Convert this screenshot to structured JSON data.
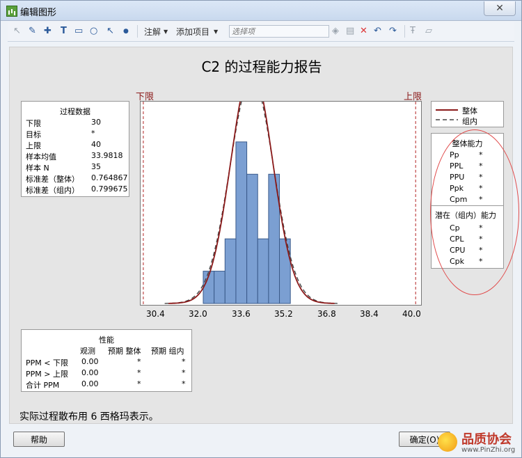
{
  "window": {
    "title": "编辑图形",
    "close": "✕"
  },
  "toolbar": {
    "annotate": "注解",
    "add_item": "添加项目",
    "select_placeholder": "选择项"
  },
  "report": {
    "title": "C2 的过程能力报告",
    "lsl_label": "下限",
    "usl_label": "上限"
  },
  "process_data": {
    "header": "过程数据",
    "rows": [
      {
        "label": "下限",
        "value": "30"
      },
      {
        "label": "目标",
        "value": "*"
      },
      {
        "label": "上限",
        "value": "40"
      },
      {
        "label": "样本均值",
        "value": "33.9818"
      },
      {
        "label": "样本 N",
        "value": "35"
      },
      {
        "label": "标准差（整体）",
        "value": "0.764867"
      },
      {
        "label": "标准差（组内）",
        "value": "0.799675"
      }
    ]
  },
  "legend": {
    "overall": "整体",
    "within": "组内"
  },
  "overall_capability": {
    "header": "整体能力",
    "rows": [
      {
        "label": "Pp",
        "value": "*"
      },
      {
        "label": "PPL",
        "value": "*"
      },
      {
        "label": "PPU",
        "value": "*"
      },
      {
        "label": "Ppk",
        "value": "*"
      },
      {
        "label": "Cpm",
        "value": "*"
      }
    ]
  },
  "potential_capability": {
    "header": "潜在（组内）能力",
    "rows": [
      {
        "label": "Cp",
        "value": "*"
      },
      {
        "label": "CPL",
        "value": "*"
      },
      {
        "label": "CPU",
        "value": "*"
      },
      {
        "label": "Cpk",
        "value": "*"
      }
    ]
  },
  "performance": {
    "header": "性能",
    "col_observed": "观测",
    "col_exp_overall": "预期 整体",
    "col_exp_within": "预期 组内",
    "rows": [
      {
        "label": "PPM < 下限",
        "obs": "0.00",
        "overall": "*",
        "within": "*"
      },
      {
        "label": "PPM > 上限",
        "obs": "0.00",
        "overall": "*",
        "within": "*"
      },
      {
        "label": "合计 PPM",
        "obs": "0.00",
        "overall": "*",
        "within": "*"
      }
    ]
  },
  "note": "实际过程散布用 6 西格玛表示。",
  "buttons": {
    "help": "帮助",
    "ok": "确定(O)"
  },
  "watermark": {
    "text": "品质协会",
    "url": "www.PinZhi.org"
  },
  "chart_data": {
    "type": "bar",
    "x_ticks": [
      "30.4",
      "32.0",
      "33.6",
      "35.2",
      "36.8",
      "38.4",
      "40.0"
    ],
    "xlim": [
      29.9,
      40.2
    ],
    "bins": [
      {
        "from": 32.2,
        "to": 32.6,
        "count": 1
      },
      {
        "from": 32.6,
        "to": 33.0,
        "count": 1
      },
      {
        "from": 33.0,
        "to": 33.4,
        "count": 2
      },
      {
        "from": 33.4,
        "to": 33.8,
        "count": 5
      },
      {
        "from": 33.8,
        "to": 34.2,
        "count": 4
      },
      {
        "from": 34.2,
        "to": 34.6,
        "count": 2
      },
      {
        "from": 34.6,
        "to": 35.0,
        "count": 4
      },
      {
        "from": 35.0,
        "to": 35.4,
        "count": 2
      }
    ],
    "lsl": 30,
    "usl": 40,
    "mean": 33.9818,
    "sd_overall": 0.764867,
    "sd_within": 0.799675,
    "n": 35,
    "bin_width": 0.4,
    "colors": {
      "bar": "#7b9fd2",
      "overall": "#8b1a1a",
      "within": "#444444",
      "limit": "#b22222"
    }
  }
}
